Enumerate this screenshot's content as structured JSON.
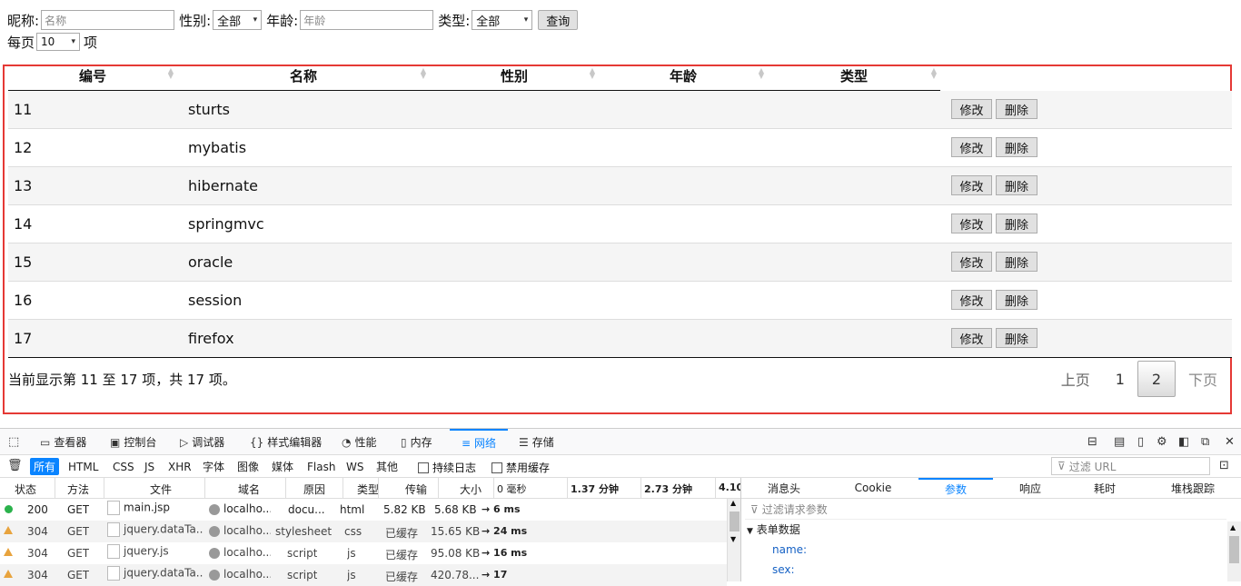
{
  "search": {
    "nickname_label": "昵称:",
    "nickname_placeholder": "名称",
    "sex_label": "性别:",
    "sex_value": "全部",
    "age_label": "年龄:",
    "age_placeholder": "年龄",
    "type_label": "类型:",
    "type_value": "全部",
    "query_button": "查询"
  },
  "length": {
    "prefix": "每页",
    "value": "10",
    "suffix": "项"
  },
  "table": {
    "columns": [
      "编号",
      "名称",
      "性别",
      "年龄",
      "类型"
    ],
    "rows": [
      {
        "id": "11",
        "name": "sturts"
      },
      {
        "id": "12",
        "name": "mybatis"
      },
      {
        "id": "13",
        "name": "hibernate"
      },
      {
        "id": "14",
        "name": "springmvc"
      },
      {
        "id": "15",
        "name": "oracle"
      },
      {
        "id": "16",
        "name": "session"
      },
      {
        "id": "17",
        "name": "firefox"
      }
    ],
    "edit_label": "修改",
    "delete_label": "删除",
    "info": "当前显示第 11 至 17 项，共 17 项。"
  },
  "pager": {
    "prev": "上页",
    "pages": [
      "1",
      "2"
    ],
    "current": "2",
    "next": "下页"
  },
  "devtools": {
    "tabs": [
      "查看器",
      "控制台",
      "调试器",
      "样式编辑器",
      "性能",
      "内存",
      "网络",
      "存储"
    ],
    "active_tab": "网络",
    "filters": [
      "所有",
      "HTML",
      "CSS",
      "JS",
      "XHR",
      "字体",
      "图像",
      "媒体",
      "Flash",
      "WS",
      "其他"
    ],
    "persist_log": "持续日志",
    "disable_cache": "禁用缓存",
    "url_filter_placeholder": "过滤 URL",
    "columns": [
      "状态",
      "方法",
      "文件",
      "域名",
      "原因",
      "类型",
      "传输",
      "大小"
    ],
    "timeline": [
      "0 毫秒",
      "1.37 分钟",
      "2.73 分钟",
      "4.10"
    ],
    "requests": [
      {
        "status": "200",
        "method": "GET",
        "file": "main.jsp",
        "domain": "localho...",
        "cause": "docu...",
        "type": "html",
        "transfer": "5.82 KB",
        "size": "5.68 KB",
        "time": "→ 6 ms"
      },
      {
        "status": "304",
        "method": "GET",
        "file": "jquery.dataTa...",
        "domain": "localho...",
        "cause": "stylesheet",
        "type": "css",
        "transfer": "已缓存",
        "size": "15.65 KB",
        "time": "→ 24 ms"
      },
      {
        "status": "304",
        "method": "GET",
        "file": "jquery.js",
        "domain": "localho...",
        "cause": "script",
        "type": "js",
        "transfer": "已缓存",
        "size": "95.08 KB",
        "time": "→ 16 ms"
      },
      {
        "status": "304",
        "method": "GET",
        "file": "jquery.dataTa...",
        "domain": "localho...",
        "cause": "script",
        "type": "js",
        "transfer": "已缓存",
        "size": "420.78...",
        "time": "→ 17"
      }
    ],
    "side_tabs": [
      "消息头",
      "Cookie",
      "参数",
      "响应",
      "耗时",
      "堆栈跟踪"
    ],
    "active_side_tab": "参数",
    "param_filter_placeholder": "过滤请求参数",
    "form_section": "表单数据",
    "params": [
      "name:",
      "sex:"
    ],
    "colors": {
      "accent": "#0a84ff",
      "panel_border": "#e53935",
      "ok": "#2bb24c",
      "warn": "#e8a33d"
    }
  }
}
